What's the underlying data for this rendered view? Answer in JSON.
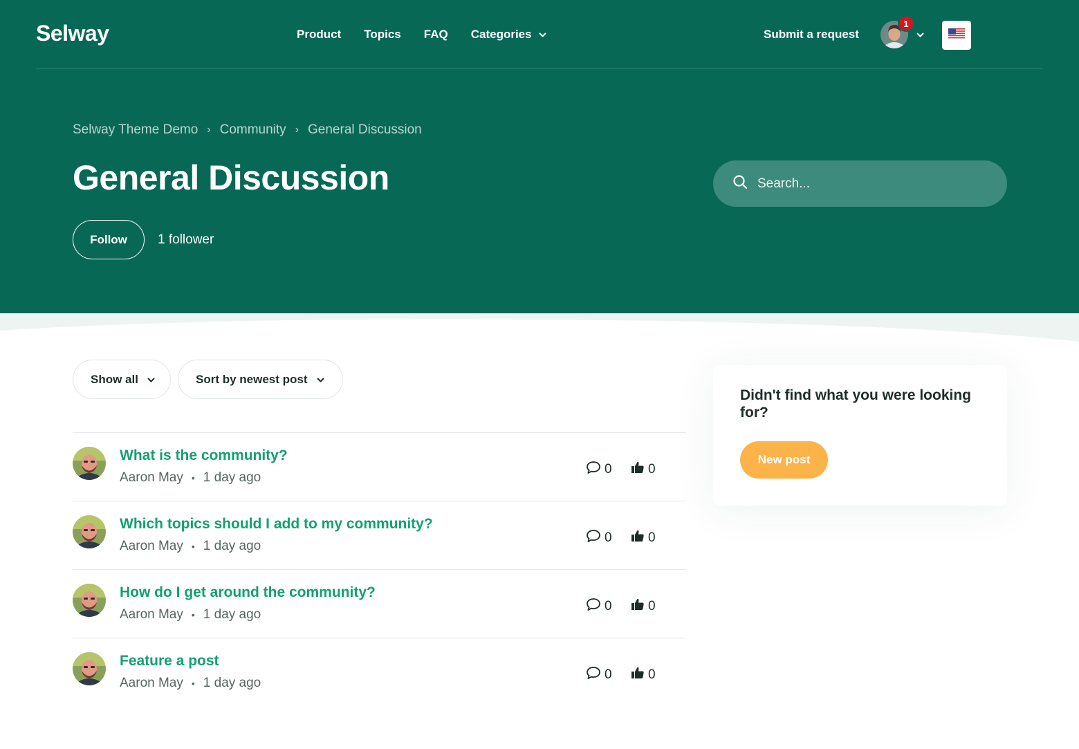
{
  "header": {
    "logo": "Selway",
    "nav": [
      {
        "label": "Product"
      },
      {
        "label": "Topics"
      },
      {
        "label": "FAQ"
      },
      {
        "label": "Categories",
        "has_dropdown": true
      }
    ],
    "submit_request": "Submit a request",
    "notification_count": "1",
    "language_icon": "us-flag-icon"
  },
  "breadcrumb": [
    "Selway Theme Demo",
    "Community",
    "General Discussion"
  ],
  "page": {
    "title": "General Discussion",
    "follow_label": "Follow",
    "followers": "1 follower"
  },
  "search": {
    "placeholder": "Search..."
  },
  "filters": {
    "show": "Show all",
    "sort": "Sort by newest post"
  },
  "posts": [
    {
      "title": "What is the community?",
      "author": "Aaron May",
      "time": "1 day ago",
      "comments": "0",
      "votes": "0"
    },
    {
      "title": "Which topics should I add to my community?",
      "author": "Aaron May",
      "time": "1 day ago",
      "comments": "0",
      "votes": "0"
    },
    {
      "title": "How do I get around the community?",
      "author": "Aaron May",
      "time": "1 day ago",
      "comments": "0",
      "votes": "0"
    },
    {
      "title": "Feature a post",
      "author": "Aaron May",
      "time": "1 day ago",
      "comments": "0",
      "votes": "0"
    }
  ],
  "sidebar": {
    "question": "Didn't find what you were looking for?",
    "new_post": "New post"
  },
  "colors": {
    "brand": "#086856",
    "link": "#13a06f",
    "accent": "#fcb34a",
    "badge": "#d8141c"
  }
}
